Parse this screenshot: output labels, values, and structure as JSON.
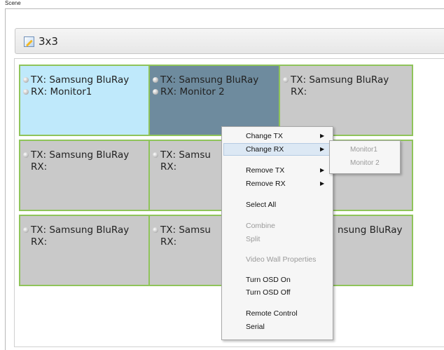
{
  "scene": {
    "title": "Scene"
  },
  "header": {
    "layout_name": "3x3",
    "layout_icon": "edit-layout-icon"
  },
  "cells": [
    {
      "tx": "TX: Samsung BluRay",
      "rx": "RX: Monitor1"
    },
    {
      "tx": "TX: Samsung BluRay",
      "rx": "RX: Monitor 2"
    },
    {
      "tx": "TX: Samsung BluRay",
      "rx": "RX:"
    },
    {
      "tx": "TX: Samsung BluRay",
      "rx": "RX:"
    },
    {
      "tx": "TX: Samsu",
      "rx": "RX:"
    },
    {
      "tx": "",
      "rx": ""
    },
    {
      "tx": "TX: Samsung BluRay",
      "rx": "RX:"
    },
    {
      "tx": "TX: Samsu",
      "rx": "RX:"
    },
    {
      "tx": "nsung BluRay",
      "rx": ""
    }
  ],
  "context_menu": {
    "change_tx": "Change TX",
    "change_rx": "Change RX",
    "remove_tx": "Remove TX",
    "remove_rx": "Remove RX",
    "select_all": "Select All",
    "combine": "Combine",
    "split": "Split",
    "video_wall_properties": "Video Wall Properties",
    "turn_osd_on": "Turn OSD On",
    "turn_osd_off": "Turn OSD Off",
    "remote_control": "Remote Control",
    "serial": "Serial",
    "submenu_arrow": "▶"
  },
  "submenu": {
    "monitor1": "Monitor1",
    "monitor2": "Monitor 2"
  },
  "colors": {
    "cell_border": "#8fc45a",
    "cell_selected_light": "#bfe9fb",
    "cell_selected_dark": "#6e8b9e",
    "cell_default": "#c9c9c9"
  }
}
